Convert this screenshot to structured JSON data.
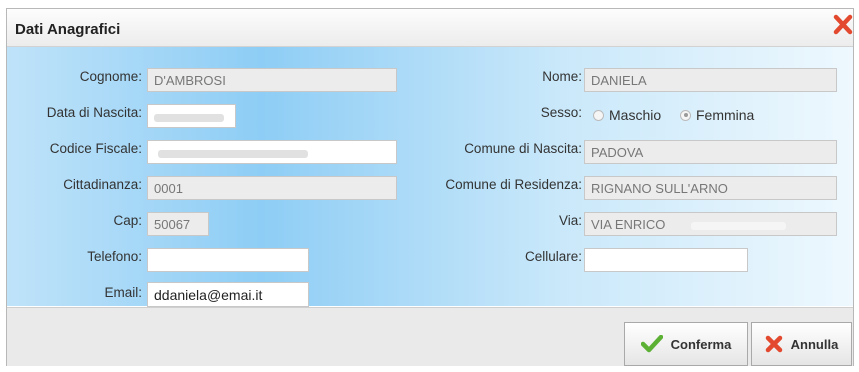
{
  "dialog": {
    "title": "Dati Anagrafici",
    "close_icon": "close-x-icon"
  },
  "fields": {
    "cognome": {
      "label": "Cognome:",
      "value": "D'AMBROSI"
    },
    "nome": {
      "label": "Nome:",
      "value": "DANIELA"
    },
    "data_nascita": {
      "label": "Data di Nascita:"
    },
    "sesso": {
      "label": "Sesso:",
      "options": [
        "Maschio",
        "Femmina"
      ],
      "selected": "Femmina"
    },
    "codice_fiscale": {
      "label": "Codice Fiscale:"
    },
    "comune_nascita": {
      "label": "Comune di Nascita:",
      "value": "PADOVA"
    },
    "cittadinanza": {
      "label": "Cittadinanza:",
      "value": "0001"
    },
    "comune_residenza": {
      "label": "Comune di Residenza:",
      "value": "RIGNANO SULL'ARNO"
    },
    "cap": {
      "label": "Cap:",
      "value": "50067"
    },
    "via": {
      "label": "Via:",
      "value": "VIA ENRICO"
    },
    "telefono": {
      "label": "Telefono:",
      "value": ""
    },
    "cellulare": {
      "label": "Cellulare:",
      "value": ""
    },
    "email": {
      "label": "Email:",
      "value": "ddaniela@emai.it"
    }
  },
  "buttons": {
    "conferma": {
      "label": "Conferma",
      "icon": "check-icon",
      "color": "#5cb135"
    },
    "annulla": {
      "label": "Annulla",
      "icon": "x-icon",
      "color": "#e2492f"
    }
  },
  "colors": {
    "panel_gradient_start": "#bfe3f9",
    "panel_gradient_mid": "#8ecdf5",
    "panel_gradient_end": "#eef8fe"
  }
}
